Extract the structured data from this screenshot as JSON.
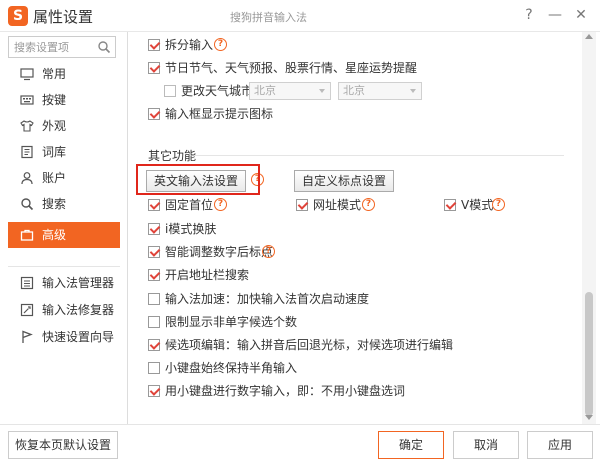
{
  "titlebar": {
    "app_title": "属性设置",
    "window_title": "搜狗拼音输入法",
    "help_label": "?",
    "minimize_label": "—",
    "close_label": "✕"
  },
  "sidebar": {
    "search_placeholder": "搜索设置项",
    "items": [
      {
        "label": "常用",
        "icon": "monitor-icon"
      },
      {
        "label": "按键",
        "icon": "keyboard-icon"
      },
      {
        "label": "外观",
        "icon": "shirt-icon"
      },
      {
        "label": "词库",
        "icon": "book-icon"
      },
      {
        "label": "账户",
        "icon": "user-icon"
      },
      {
        "label": "搜索",
        "icon": "search-icon"
      },
      {
        "label": "高级",
        "icon": "briefcase-icon",
        "active": true
      }
    ],
    "tools": [
      {
        "label": "输入法管理器",
        "icon": "manager-icon"
      },
      {
        "label": "输入法修复器",
        "icon": "repair-icon"
      },
      {
        "label": "快速设置向导",
        "icon": "wizard-icon"
      }
    ]
  },
  "content": {
    "top_options": {
      "split_input": {
        "label": "拆分输入",
        "checked": true
      },
      "festival": {
        "label": "节日节气、天气预报、股票行情、星座运势提醒",
        "checked": true
      },
      "change_city": {
        "label": "更改天气城市",
        "checked": false
      },
      "city_select_1": "北京",
      "city_select_2": "北京",
      "show_tip_icon": {
        "label": "输入框显示提示图标",
        "checked": true
      }
    },
    "other_section_title": "其它功能",
    "english_settings_button": "英文输入法设置",
    "custom_punct_button": "自定义标点设置",
    "options": [
      {
        "label": "固定首位",
        "checked": true
      },
      {
        "label": "网址模式",
        "checked": true
      },
      {
        "label": "V模式",
        "checked": true
      },
      {
        "label": "i模式换肤",
        "checked": true
      },
      {
        "label": "智能调整数字后标点",
        "checked": true
      },
      {
        "label": "开启地址栏搜索",
        "checked": true
      },
      {
        "label": "输入法加速：加快输入法首次启动速度",
        "checked": false
      },
      {
        "label": "限制显示非单字候选个数",
        "checked": false
      },
      {
        "label": "候选项编辑：输入拼音后回退光标，对候选项进行编辑",
        "checked": true
      },
      {
        "label": "小键盘始终保持半角输入",
        "checked": false
      },
      {
        "label": "用小键盘进行数字输入，即：不用小键盘选词",
        "checked": true
      }
    ],
    "help_glyph": "?"
  },
  "footer": {
    "restore_label": "恢复本页默认设置",
    "ok_label": "确定",
    "cancel_label": "取消",
    "apply_label": "应用"
  },
  "colors": {
    "accent": "#f26522",
    "highlight_box": "#e0261b",
    "check": "#e0443a"
  }
}
